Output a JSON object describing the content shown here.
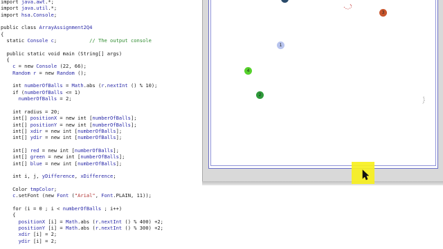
{
  "editor": {
    "lines": [
      "import java.awt.*;",
      "import java.util.*;",
      "import hsa.Console;",
      "",
      "public class ArrayAssignment2Q4",
      "{",
      "  static Console c;           // The output console",
      "",
      "  public static void main (String[] args)",
      "  {",
      "    c = new Console (22, 66);",
      "    Random r = new Random ();",
      "",
      "    int numberOfBalls = Math.abs (r.nextInt () % 10);",
      "    if (numberOfBalls <= 1)",
      "      numberOfBalls = 2;",
      "",
      "    int radius = 20;",
      "    int[] positionX = new int [numberOfBalls];",
      "    int[] positionY = new int [numberOfBalls];",
      "    int[] xdir = new int [numberOfBalls];",
      "    int[] ydir = new int [numberOfBalls];",
      "",
      "    int[] red = new int [numberOfBalls];",
      "    int[] green = new int [numberOfBalls];",
      "    int[] blue = new int [numberOfBalls];",
      "",
      "    int i, j, yDifference, xDifference;",
      "",
      "    Color tmpColor;",
      "    c.setFont (new Font (\"Arial\", Font.PLAIN, 11));",
      "",
      "    for (i = 0 ; i < numberOfBalls ; i++)",
      "    {",
      "      positionX [i] = Math.abs (r.nextInt () % 400) +2;",
      "      positionY [i] = Math.abs (r.nextInt () % 300) +2;",
      "      xdir [i] = 2;",
      "      ydir [i] = 2;"
    ]
  },
  "canvas": {
    "balls": [
      {
        "label": "1",
        "color": "#b8c4ee"
      },
      {
        "label": "2",
        "color": "#2e9a3a"
      },
      {
        "label": "3",
        "color": "#c8552c"
      },
      {
        "label": "4",
        "color": "#56d12c"
      },
      {
        "label": "",
        "color": "#2a4a6a"
      }
    ]
  },
  "colors": {
    "highlight": "#f7f020",
    "canvas_border": "#6b6fc7"
  }
}
